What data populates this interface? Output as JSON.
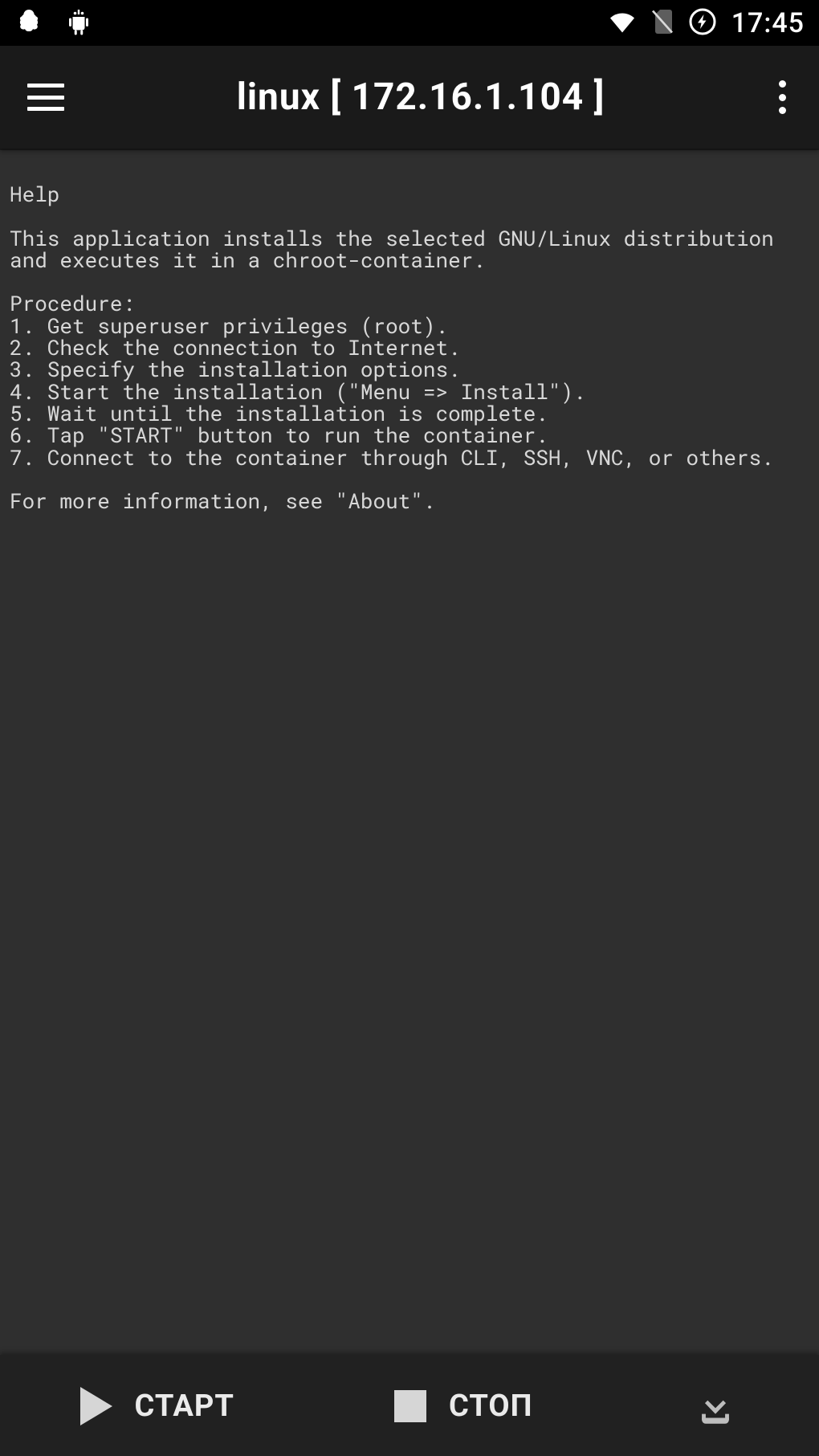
{
  "status": {
    "time": "17:45"
  },
  "header": {
    "title": "linux  [ 172.16.1.104 ]"
  },
  "content": {
    "text": "Help\n\nThis application installs the selected GNU/Linux distribution and executes it in a chroot-container.\n\nProcedure:\n1. Get superuser privileges (root).\n2. Check the connection to Internet.\n3. Specify the installation options.\n4. Start the installation (\"Menu => Install\").\n5. Wait until the installation is complete.\n6. Tap \"START\" button to run the container.\n7. Connect to the container through CLI, SSH, VNC, or others.\n\nFor more information, see \"About\"."
  },
  "bottom": {
    "start": "СТАРТ",
    "stop": "СТОП"
  }
}
